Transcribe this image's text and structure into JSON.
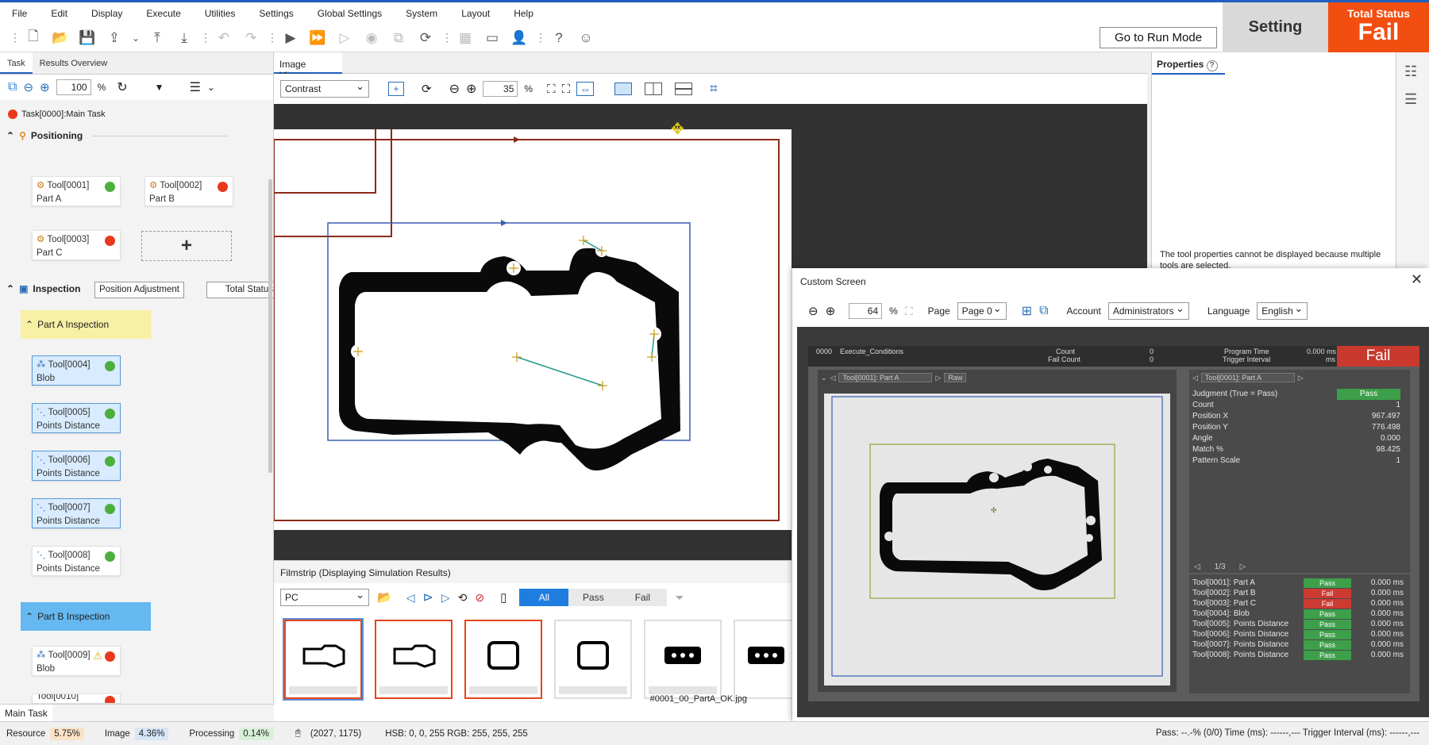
{
  "menu": [
    "File",
    "Edit",
    "Display",
    "Execute",
    "Utilities",
    "Settings",
    "Global Settings",
    "System",
    "Layout",
    "Help"
  ],
  "toolbar": {
    "run_mode_label": "Go to Run Mode"
  },
  "mode": {
    "label": "Setting"
  },
  "total_status": {
    "title": "Total Status",
    "value": "Fail",
    "color": "#f24e10"
  },
  "left": {
    "tabs": [
      "Task",
      "Results Overview"
    ],
    "zoom": "100",
    "zoom_unit": "%",
    "task_name": "Task[0000]:Main Task",
    "positioning": {
      "title": "Positioning",
      "tools": [
        {
          "id": "Tool[0001]",
          "type": "Part A",
          "status": "green"
        },
        {
          "id": "Tool[0002]",
          "type": "Part B",
          "status": "red"
        },
        {
          "id": "Tool[0003]",
          "type": "Part C",
          "status": "red"
        }
      ],
      "add_label": "+"
    },
    "inspection": {
      "title": "Inspection",
      "btn_position_adjustment": "Position Adjustment",
      "btn_total_status": "Total Status",
      "group_a": "Part A Inspection",
      "group_b": "Part B Inspection",
      "tools_a": [
        {
          "id": "Tool[0004]",
          "type": "Blob",
          "status": "green"
        },
        {
          "id": "Tool[0005]",
          "type": "Points Distance",
          "status": "green"
        },
        {
          "id": "Tool[0006]",
          "type": "Points Distance",
          "status": "green"
        },
        {
          "id": "Tool[0007]",
          "type": "Points Distance",
          "status": "green"
        },
        {
          "id": "Tool[0008]",
          "type": "Points Distance",
          "status": "green"
        }
      ],
      "tools_b": [
        {
          "id": "Tool[0009]",
          "type": "Blob",
          "status": "red"
        },
        {
          "id": "Tool[0010]",
          "type": "",
          "status": "red"
        }
      ]
    },
    "bottom_tab": "Main Task"
  },
  "image_viewer": {
    "tab": "Image Viewer",
    "mode": "Contrast",
    "zoom": "35",
    "zoom_unit": "%"
  },
  "properties": {
    "tab": "Properties",
    "message": "The tool properties cannot be displayed because multiple tools are selected."
  },
  "filmstrip": {
    "title": "Filmstrip (Displaying Simulation Results)",
    "source": "PC",
    "filters": [
      "All",
      "Pass",
      "Fail"
    ],
    "active_filter": "All",
    "filename": "#0001_00_PartA_OK.jpg"
  },
  "custom_screen": {
    "title": "Custom Screen",
    "zoom": "64",
    "zoom_unit": "%",
    "page_label": "Page",
    "page": "Page 0",
    "account_label": "Account",
    "account": "Administrators",
    "language_label": "Language",
    "language": "English",
    "head": {
      "num": "0000",
      "cond": "Execute_Conditions",
      "count_label": "Count",
      "count": "0",
      "failcount_label": "Fail Count",
      "failcount": "0",
      "progtime_label": "Program Time",
      "progtime": "0.000 ms",
      "trigger_label": "Trigger Interval",
      "trigger": "ms",
      "result": "Fail"
    },
    "left_combo": "Tool[0001]: Part A",
    "left_combo2": "Raw",
    "right_combo": "Tool[0001]: Part A",
    "results": [
      {
        "k": "Judgment (True = Pass)",
        "v": "Pass"
      },
      {
        "k": "Count",
        "v": "1"
      },
      {
        "k": "Position X",
        "v": "967.497"
      },
      {
        "k": "Position Y",
        "v": "776.498"
      },
      {
        "k": "Angle",
        "v": "0.000"
      },
      {
        "k": "Match %",
        "v": "98.425"
      },
      {
        "k": "Pattern Scale",
        "v": "1"
      }
    ],
    "page_counter": "1/3",
    "tool_list": [
      {
        "name": "Tool[0001]: Part A",
        "status": "Pass",
        "ms": "0.000  ms"
      },
      {
        "name": "Tool[0002]: Part B",
        "status": "Fail",
        "ms": "0.000  ms"
      },
      {
        "name": "Tool[0003]: Part C",
        "status": "Fail",
        "ms": "0.000  ms"
      },
      {
        "name": "Tool[0004]: Blob",
        "status": "Pass",
        "ms": "0.000  ms"
      },
      {
        "name": "Tool[0005]: Points Distance",
        "status": "Pass",
        "ms": "0.000  ms"
      },
      {
        "name": "Tool[0006]: Points Distance",
        "status": "Pass",
        "ms": "0.000  ms"
      },
      {
        "name": "Tool[0007]: Points Distance",
        "status": "Pass",
        "ms": "0.000  ms"
      },
      {
        "name": "Tool[0008]: Points Distance",
        "status": "Pass",
        "ms": "0.000  ms"
      }
    ]
  },
  "status": {
    "resource_label": "Resource",
    "resource": "5.75%",
    "image_label": "Image",
    "image": "4.36%",
    "processing_label": "Processing",
    "processing": "0.14%",
    "coords": "(2027, 1175)",
    "pixel": "HSB: 0, 0, 255 RGB: 255, 255, 255",
    "right": "Pass: --.-% (0/0) Time (ms): ------,--- Trigger Interval (ms): ------,---"
  }
}
